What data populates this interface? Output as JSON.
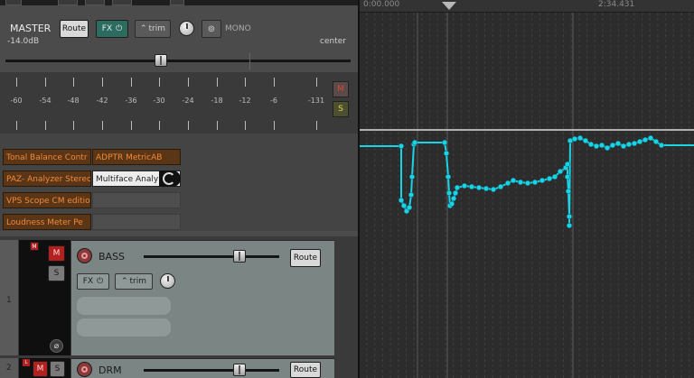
{
  "master": {
    "name": "MASTER",
    "volume": "-14.0dB",
    "pan": "center",
    "route_label": "Route",
    "fx_label": "FX",
    "trim_label": "trim",
    "mono_label": "MONO",
    "mute_label": "M",
    "solo_label": "S",
    "meter_labels": [
      "-60",
      "-54",
      "-48",
      "-42",
      "-36",
      "-30",
      "-24",
      "-18",
      "-12",
      "-6",
      "-131"
    ],
    "fx_chain": [
      {
        "col1": "Tonal Balance Contr",
        "col2": "ADPTR MetricAB"
      },
      {
        "col1": "PAZ- Analyzer Stereo",
        "col2": "Multiface Analy"
      },
      {
        "col1": "VPS Scope CM editio",
        "col2": ""
      },
      {
        "col1": "Loudness Meter Pe",
        "col2": ""
      }
    ]
  },
  "tracks": [
    {
      "number": "1",
      "name": "BASS",
      "route_label": "Route",
      "fx_label": "FX",
      "trim_label": "trim",
      "mute_label": "M",
      "solo_label": "S",
      "phase_label": "⌀"
    },
    {
      "number": "2",
      "name": "DRM",
      "route_label": "Route",
      "mute_label": "M",
      "solo_label": "S"
    }
  ],
  "timeline": {
    "start": "0:00.000",
    "marker": "2:34.431"
  },
  "colors": {
    "envelope": "#1bd3e6",
    "fx_orange": "#f08a3c",
    "mute_red": "#b32020",
    "fx_teal": "#2c6c60"
  }
}
